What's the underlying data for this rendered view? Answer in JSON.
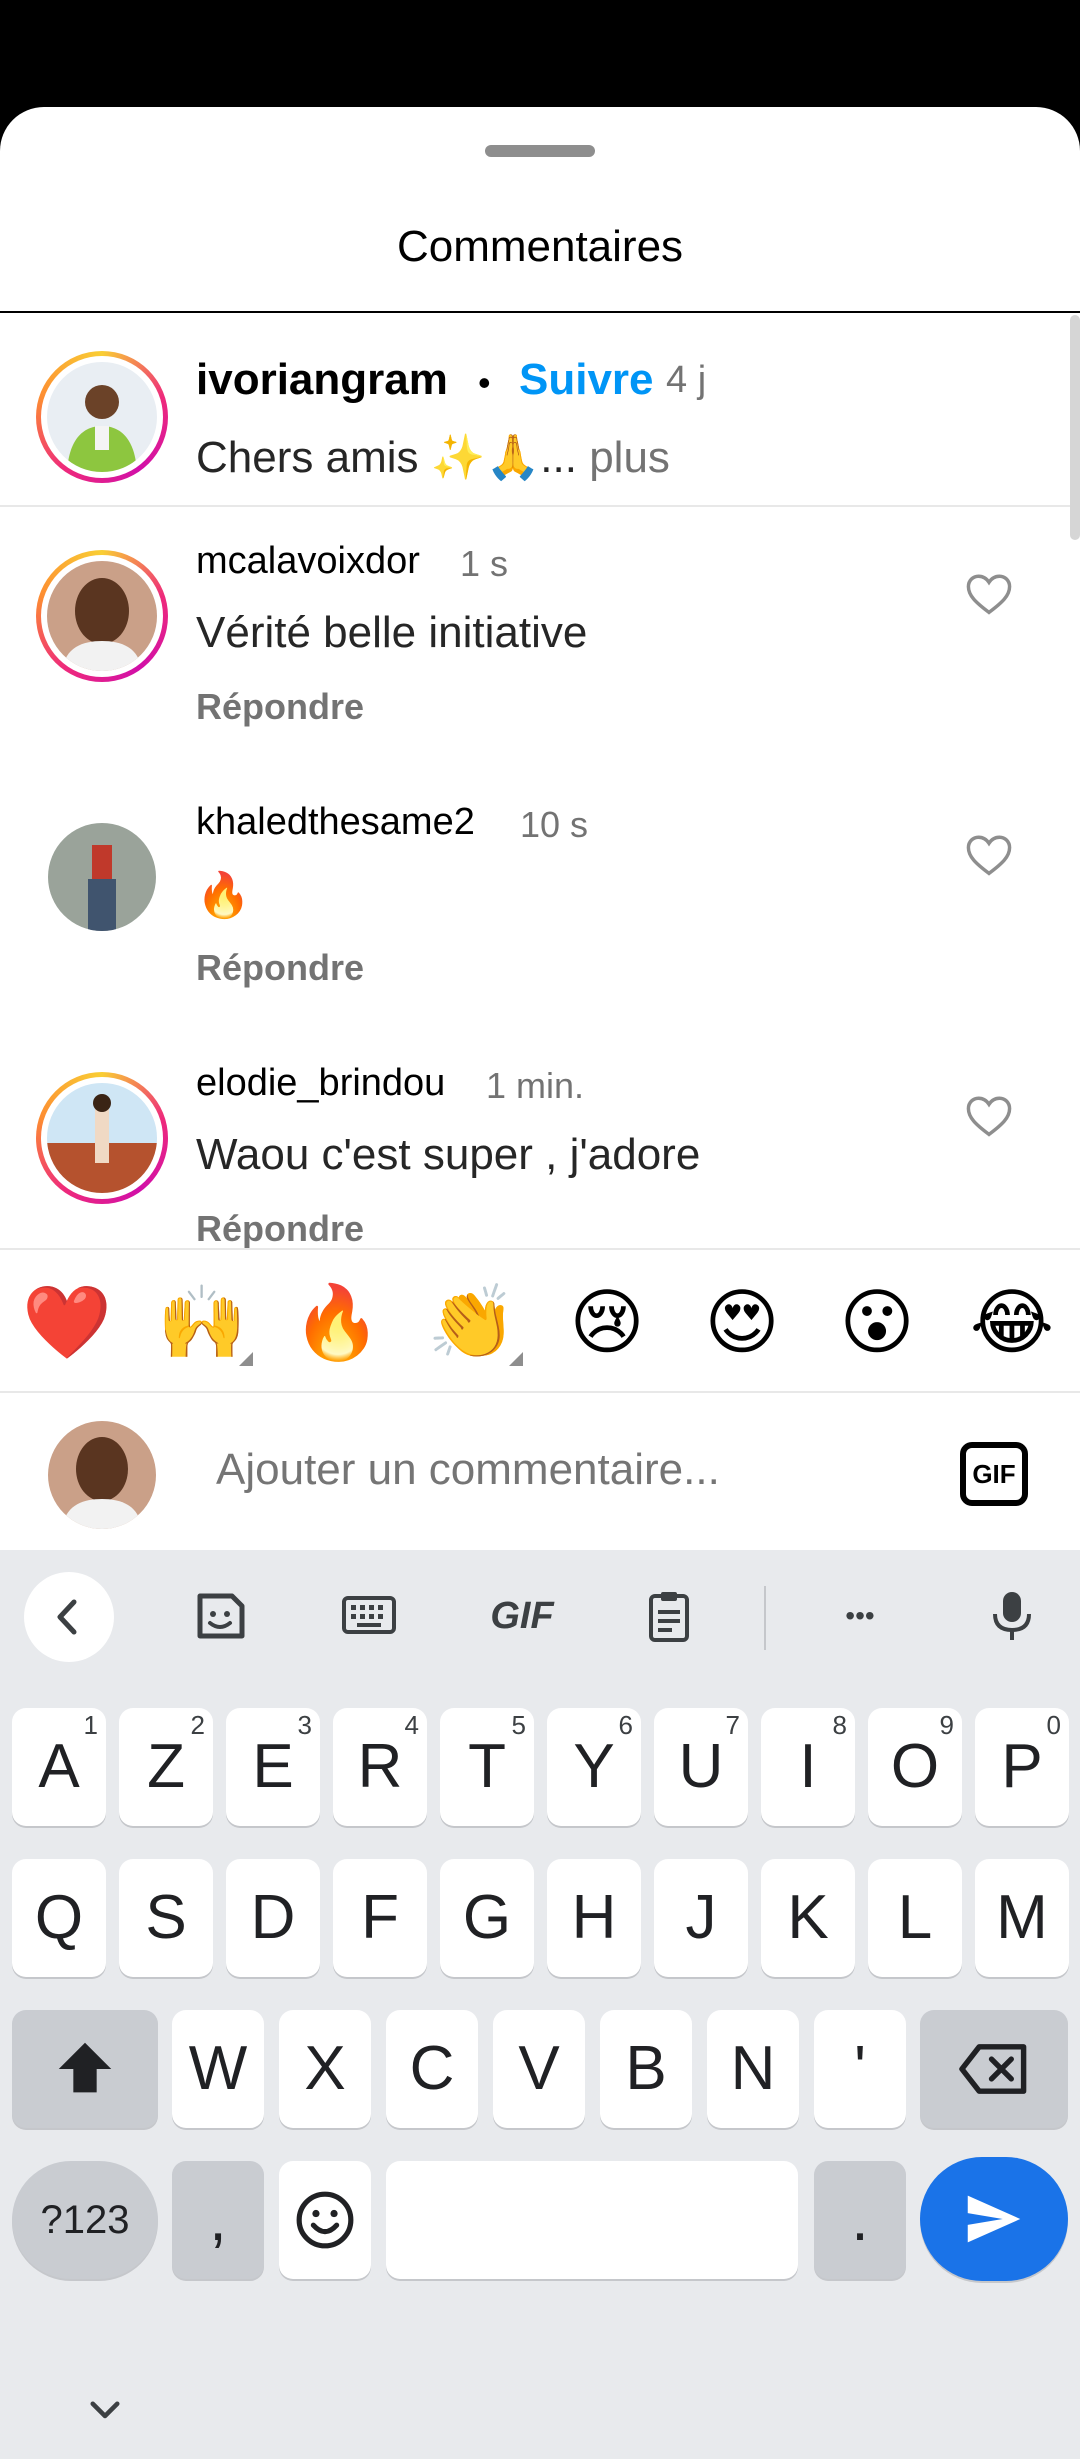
{
  "sheet": {
    "title": "Commentaires"
  },
  "caption": {
    "username": "ivoriangram",
    "dot": "•",
    "follow": "Suivre",
    "time": "4 j",
    "text": "Chers amis ✨🙏...",
    "more": " plus"
  },
  "comments": [
    {
      "username": "mcalavoixdor",
      "time": "1 s",
      "text": "Vérité belle initiative",
      "reply": "Répondre"
    },
    {
      "username": "khaledthesame2",
      "time": "10 s",
      "text": "🔥",
      "reply": "Répondre"
    },
    {
      "username": "elodie_brindou",
      "time": "1 min.",
      "text": "Waou c'est super , j'adore",
      "reply": "Répondre"
    }
  ],
  "reactions": [
    "❤️",
    "🙌",
    "🔥",
    "👏",
    "😢",
    "😍",
    "😮",
    "😂"
  ],
  "input": {
    "placeholder": "Ajouter un commentaire...",
    "gif_label": "GIF"
  },
  "keyboard": {
    "toolbar": {
      "gif_label": "GIF",
      "more": "•••"
    },
    "row1": [
      {
        "key": "A",
        "hint": "1"
      },
      {
        "key": "Z",
        "hint": "2"
      },
      {
        "key": "E",
        "hint": "3"
      },
      {
        "key": "R",
        "hint": "4"
      },
      {
        "key": "T",
        "hint": "5"
      },
      {
        "key": "Y",
        "hint": "6"
      },
      {
        "key": "U",
        "hint": "7"
      },
      {
        "key": "I",
        "hint": "8"
      },
      {
        "key": "O",
        "hint": "9"
      },
      {
        "key": "P",
        "hint": "0"
      }
    ],
    "row2": [
      "Q",
      "S",
      "D",
      "F",
      "G",
      "H",
      "J",
      "K",
      "L",
      "M"
    ],
    "row3": [
      "W",
      "X",
      "C",
      "V",
      "B",
      "N",
      "'"
    ],
    "row4": {
      "symbols": "?123",
      "comma": ",",
      "period": "."
    }
  },
  "colors": {
    "accent": "#0095f6",
    "send": "#1a73e8",
    "keyboard_bg": "#e8eaed"
  },
  "icons": {
    "heart": "heart-outline-icon",
    "gif": "gif-icon",
    "back": "chevron-left-icon",
    "sticker": "sticker-icon",
    "keyboard": "keyboard-icon",
    "clipboard": "clipboard-icon",
    "mic": "microphone-icon",
    "shift": "shift-icon",
    "backspace": "backspace-icon",
    "emoji": "emoji-icon",
    "send": "send-icon",
    "collapse": "chevron-down-icon"
  }
}
